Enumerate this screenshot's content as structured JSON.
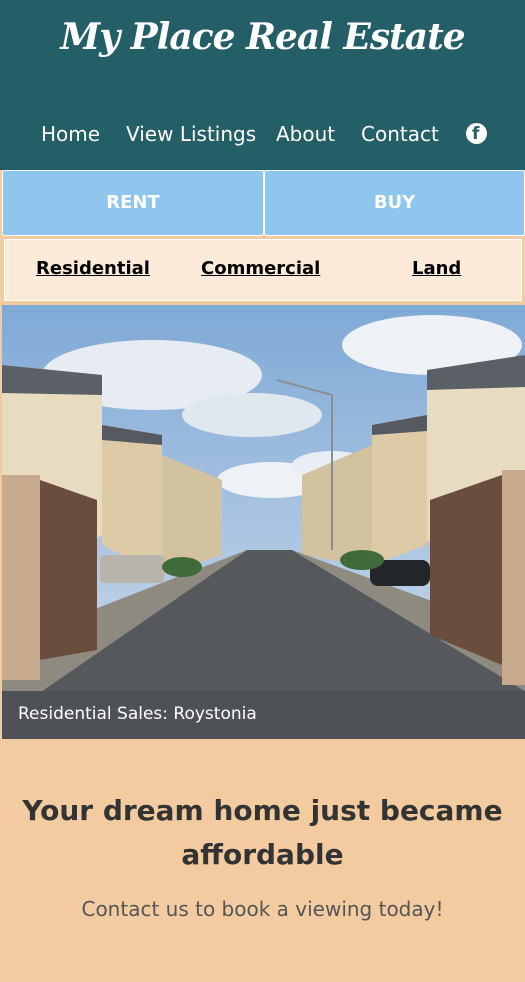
{
  "header": {
    "logo": "My Place Real Estate",
    "nav": [
      "Home",
      "View Listings",
      "About",
      "Contact"
    ],
    "social_icon": "facebook-icon"
  },
  "tabs": {
    "rent": "RENT",
    "buy": "BUY"
  },
  "categories": [
    "Residential",
    "Commercial",
    "Land"
  ],
  "hero": {
    "caption": "Residential Sales: Roystonia"
  },
  "promo": {
    "headline": "Your dream home just became affordable",
    "subtext": "Contact us to book a viewing today!"
  },
  "colors": {
    "header_bg": "#245e66",
    "tab_bg": "#8ec6ee",
    "category_bg": "#fcebd8",
    "caption_bg": "#4e5256",
    "promo_bg": "#f2cca0"
  }
}
